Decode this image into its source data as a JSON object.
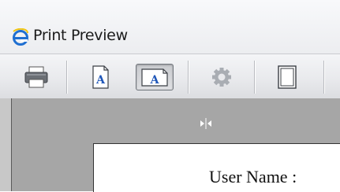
{
  "window": {
    "title": "Print Preview",
    "app_icon": "internet-explorer-icon"
  },
  "toolbar": {
    "buttons": [
      {
        "name": "print-button",
        "icon": "printer-icon",
        "pressed": false
      },
      {
        "name": "portrait-button",
        "icon": "portrait-page-icon",
        "pressed": false
      },
      {
        "name": "landscape-button",
        "icon": "landscape-page-icon",
        "pressed": true
      },
      {
        "name": "page-setup-button",
        "icon": "gear-icon",
        "pressed": false
      },
      {
        "name": "headers-footers-button",
        "icon": "page-frame-icon",
        "pressed": false
      }
    ]
  },
  "preview": {
    "page_text": "User Name :"
  },
  "colors": {
    "preview_background": "#a6a6a6",
    "toolbar_pressed": "#c9cbcf",
    "page": "#ffffff"
  }
}
